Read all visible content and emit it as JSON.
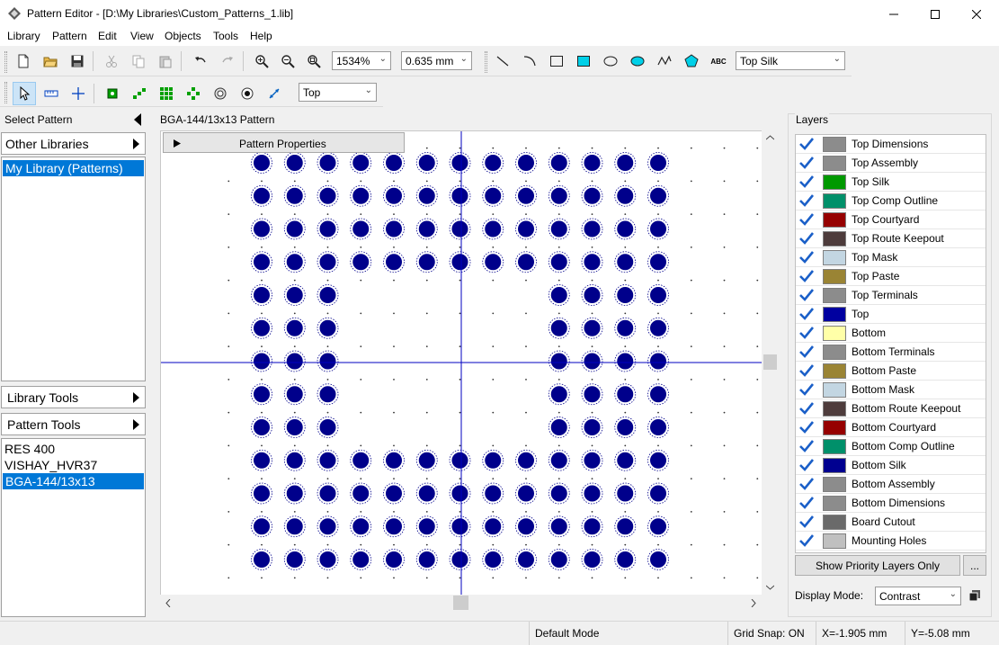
{
  "window": {
    "title": "Pattern Editor - [D:\\My Libraries\\Custom_Patterns_1.lib]"
  },
  "menu": [
    "Library",
    "Pattern",
    "Edit",
    "View",
    "Objects",
    "Tools",
    "Help"
  ],
  "toolbar": {
    "zoom_value": "1534%",
    "grid_value": "0.635 mm",
    "layer_value": "Top Silk",
    "side_value": "Top",
    "text_tool_label": "ABC"
  },
  "left_panel": {
    "header": "Select Pattern",
    "other_libraries": "Other Libraries",
    "libraries": [
      "My Library (Patterns)"
    ],
    "library_tools": "Library Tools",
    "pattern_tools": "Pattern Tools",
    "patterns": [
      "RES 400",
      "VISHAY_HVR37",
      "BGA-144/13x13"
    ],
    "selected_pattern_index": 2
  },
  "canvas": {
    "header": "BGA-144/13x13 Pattern",
    "properties_label": "Pattern Properties"
  },
  "layers_panel": {
    "header": "Layers",
    "layers": [
      {
        "name": "Top Dimensions",
        "color": "#8c8c8c",
        "checked": true
      },
      {
        "name": "Top Assembly",
        "color": "#8c8c8c",
        "checked": true
      },
      {
        "name": "Top Silk",
        "color": "#009900",
        "checked": true
      },
      {
        "name": "Top Comp Outline",
        "color": "#00906a",
        "checked": true
      },
      {
        "name": "Top Courtyard",
        "color": "#960000",
        "checked": true
      },
      {
        "name": "Top Route Keepout",
        "color": "#4e3c3c",
        "checked": true
      },
      {
        "name": "Top Mask",
        "color": "#c3d6e2",
        "checked": true
      },
      {
        "name": "Top Paste",
        "color": "#9a8434",
        "checked": true
      },
      {
        "name": "Top Terminals",
        "color": "#8c8c8c",
        "checked": true
      },
      {
        "name": "Top",
        "color": "#0000a0",
        "checked": true
      },
      {
        "name": "Bottom",
        "color": "#ffffa8",
        "checked": true
      },
      {
        "name": "Bottom Terminals",
        "color": "#8c8c8c",
        "checked": true
      },
      {
        "name": "Bottom Paste",
        "color": "#9a8434",
        "checked": true
      },
      {
        "name": "Bottom Mask",
        "color": "#c3d6e2",
        "checked": true
      },
      {
        "name": "Bottom Route Keepout",
        "color": "#4e3c3c",
        "checked": true
      },
      {
        "name": "Bottom Courtyard",
        "color": "#960000",
        "checked": true
      },
      {
        "name": "Bottom Comp Outline",
        "color": "#00906a",
        "checked": true
      },
      {
        "name": "Bottom Silk",
        "color": "#000090",
        "checked": true
      },
      {
        "name": "Bottom Assembly",
        "color": "#8c8c8c",
        "checked": true
      },
      {
        "name": "Bottom Dimensions",
        "color": "#8c8c8c",
        "checked": true
      },
      {
        "name": "Board Cutout",
        "color": "#6a6a6a",
        "checked": true
      },
      {
        "name": "Mounting Holes",
        "color": "#c0c0c0",
        "checked": true
      }
    ],
    "priority_button": "Show Priority Layers Only",
    "more_button": "...",
    "display_mode_label": "Display Mode:",
    "display_mode_value": "Contrast"
  },
  "status": {
    "mode": "Default Mode",
    "grid_snap": "Grid Snap: ON",
    "x": "X=-1.905 mm",
    "y": "Y=-5.08 mm"
  },
  "colors": {
    "pad_fill": "#00008b",
    "crosshair": "#0000c0",
    "selection": "#0078d7",
    "check": "#1a5fc8"
  }
}
